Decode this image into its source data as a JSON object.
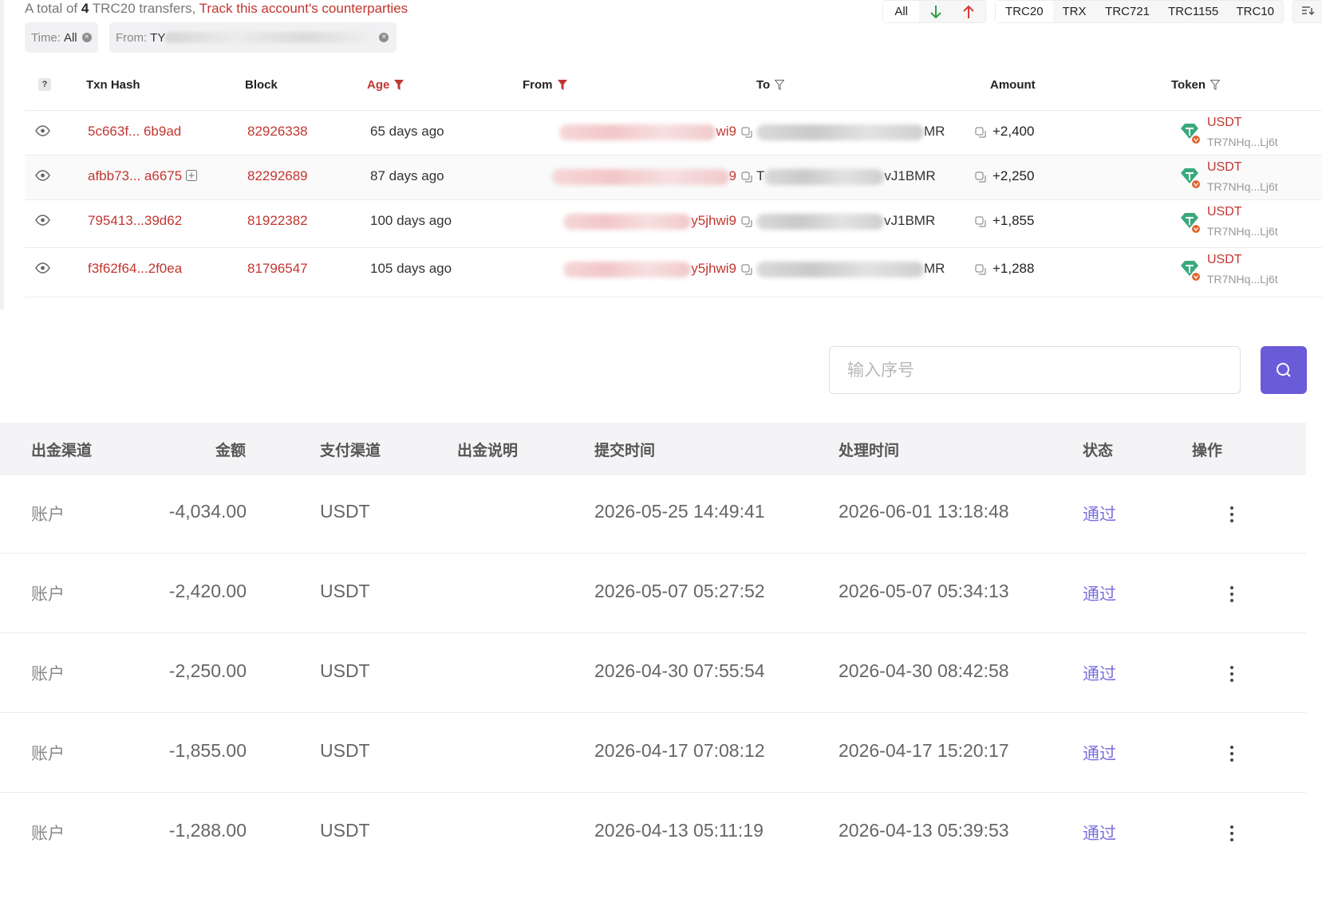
{
  "top": {
    "summary_prefix": "A total of",
    "summary_count": "4",
    "summary_suffix": "TRC20 transfers,",
    "track_link": "Track this account's counterparties",
    "chips": {
      "time_label": "Time:",
      "time_value": "All",
      "from_label": "From:",
      "from_value": "TY"
    },
    "direction_filter": {
      "all": "All"
    },
    "token_tabs": [
      "TRC20",
      "TRX",
      "TRC721",
      "TRC1155",
      "TRC10"
    ],
    "columns": {
      "help": "?",
      "txn_hash": "Txn Hash",
      "block": "Block",
      "age": "Age",
      "from": "From",
      "to": "To",
      "amount": "Amount",
      "token": "Token"
    },
    "rows": [
      {
        "hash_a": "5c663f...",
        "hash_b": "6b9ad",
        "block": "82926338",
        "age": "65 days ago",
        "from_tail": "wi9",
        "to_head": "",
        "to_tail": "MR",
        "amount": "+2,400",
        "token": "USDT",
        "token_addr": "TR7NHq...Lj6t"
      },
      {
        "hash_a": "afbb73...",
        "hash_b": "a6675",
        "block": "82292689",
        "age": "87 days ago",
        "from_tail": "9",
        "to_head": "T",
        "to_tail": "vJ1BMR",
        "amount": "+2,250",
        "token": "USDT",
        "token_addr": "TR7NHq...Lj6t"
      },
      {
        "hash_a": "795413...39d62",
        "hash_b": "",
        "block": "81922382",
        "age": "100 days ago",
        "from_tail": "y5jhwi9",
        "to_head": "",
        "to_tail": "vJ1BMR",
        "amount": "+1,855",
        "token": "USDT",
        "token_addr": "TR7NHq...Lj6t"
      },
      {
        "hash_a": "f3f62f64...2f0ea",
        "hash_b": "",
        "block": "81796547",
        "age": "105 days ago",
        "from_tail": "y5jhwi9",
        "to_head": "",
        "to_tail": "MR",
        "amount": "+1,288",
        "token": "USDT",
        "token_addr": "TR7NHq...Lj6t"
      }
    ]
  },
  "search": {
    "placeholder": "输入序号"
  },
  "withdrawals": {
    "columns": [
      "出金渠道",
      "金额",
      "支付渠道",
      "出金说明",
      "提交时间",
      "处理时间",
      "状态",
      "操作"
    ],
    "rows": [
      {
        "channel": "账户",
        "amount": "-4,034.00",
        "pay": "USDT",
        "note": "",
        "submitted": "2026-05-25 14:49:41",
        "processed": "2026-06-01 13:18:48",
        "status": "通过"
      },
      {
        "channel": "账户",
        "amount": "-2,420.00",
        "pay": "USDT",
        "note": "",
        "submitted": "2026-05-07 05:27:52",
        "processed": "2026-05-07 05:34:13",
        "status": "通过"
      },
      {
        "channel": "账户",
        "amount": "-2,250.00",
        "pay": "USDT",
        "note": "",
        "submitted": "2026-04-30 07:55:54",
        "processed": "2026-04-30 08:42:58",
        "status": "通过"
      },
      {
        "channel": "账户",
        "amount": "-1,855.00",
        "pay": "USDT",
        "note": "",
        "submitted": "2026-04-17 07:08:12",
        "processed": "2026-04-17 15:20:17",
        "status": "通过"
      },
      {
        "channel": "账户",
        "amount": "-1,288.00",
        "pay": "USDT",
        "note": "",
        "submitted": "2026-04-13 05:11:19",
        "processed": "2026-04-13 05:39:53",
        "status": "通过"
      }
    ]
  },
  "colors": {
    "link_red": "#c23631",
    "status_purple": "#7b6fe0",
    "search_button": "#6a5bd9",
    "token_green": "#3aa97c",
    "arrow_in": "#2ea043",
    "arrow_out": "#d73a3a"
  }
}
